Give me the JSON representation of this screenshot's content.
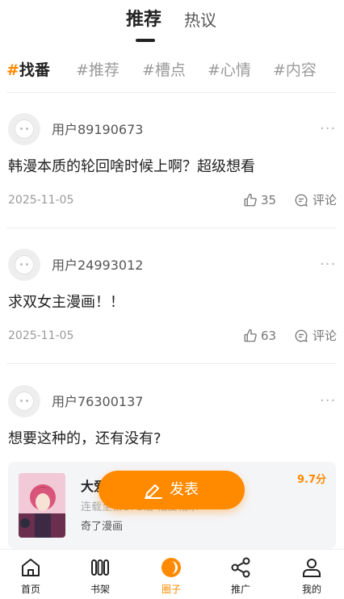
{
  "top_tabs": [
    {
      "label": "推荐",
      "active": true
    },
    {
      "label": "热议",
      "active": false
    }
  ],
  "categories": [
    {
      "hash": "#",
      "label": "找番",
      "active": true
    },
    {
      "hash": "#",
      "label": "推荐",
      "active": false
    },
    {
      "hash": "#",
      "label": "槽点",
      "active": false
    },
    {
      "hash": "#",
      "label": "心情",
      "active": false
    },
    {
      "hash": "#",
      "label": "内容",
      "active": false
    }
  ],
  "posts": [
    {
      "username": "用户89190673",
      "content": "韩漫本质的轮回啥时候上啊？超级想看",
      "date": "2025-11-05",
      "likes": "35",
      "comment_label": "评论"
    },
    {
      "username": "用户24993012",
      "content": "求双女主漫画！！",
      "date": "2025-11-05",
      "likes": "63",
      "comment_label": "评论"
    },
    {
      "username": "用户76300137",
      "content": "想要这种的，还有没有?",
      "date": "",
      "likes": "",
      "comment_label": ""
    }
  ],
  "more_glyph": "···",
  "comic_card": {
    "title": "大爱",
    "subtitle": "连载至第171话 相爱相杀",
    "publisher": "奇了漫画",
    "score": "9.7分"
  },
  "publish_button": {
    "label": "发表"
  },
  "bottom_nav": [
    {
      "label": "首页",
      "icon": "home-icon",
      "active": false
    },
    {
      "label": "书架",
      "icon": "bookshelf-icon",
      "active": false
    },
    {
      "label": "圈子",
      "icon": "circle-icon",
      "active": true
    },
    {
      "label": "推广",
      "icon": "share-icon",
      "active": false
    },
    {
      "label": "我的",
      "icon": "profile-icon",
      "active": false
    }
  ],
  "colors": {
    "accent": "#ff8a00",
    "text": "#222222",
    "muted": "#9a9a9a",
    "card_bg": "#f4f5f7"
  }
}
